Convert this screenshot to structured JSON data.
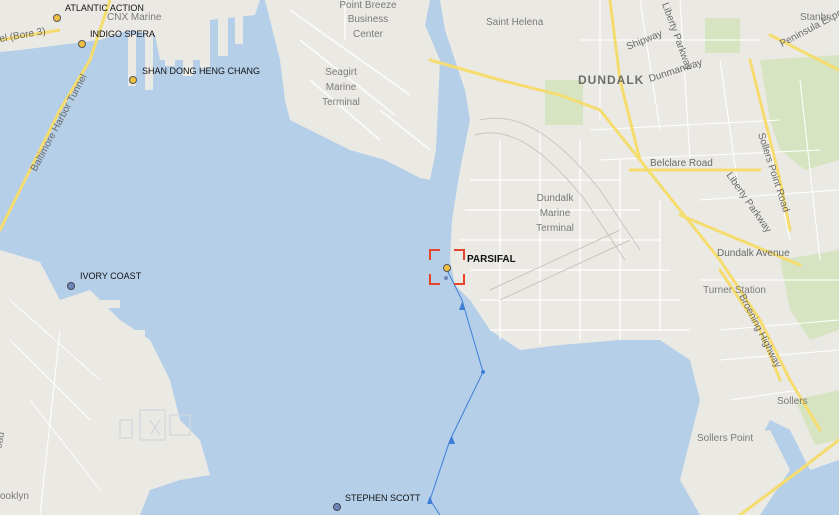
{
  "map": {
    "colors": {
      "water": "#b5cfe9",
      "land": "#ebe9e4",
      "park": "#d6e4c2",
      "major_road": "#f5dc6e",
      "track_line": "#3f7ed6",
      "selection": "#e2452b",
      "vessel_marker": "#6b86b8",
      "vessel_label_marker": "#f0c040"
    },
    "places": {
      "point_breeze": [
        "Point Breeze",
        "Business",
        "Center"
      ],
      "seagirt": [
        "Seagirt",
        "Marine",
        "Terminal"
      ],
      "saint_helena": "Saint Helena",
      "dundalk": "DUNDALK",
      "dundalk_marine": [
        "Dundalk",
        "Marine",
        "Terminal"
      ],
      "turner_station": "Turner Station",
      "sollers": "Sollers",
      "sollers_point": "Sollers Point",
      "stanbr": "Stanbr",
      "brooklyn": "ooklyn",
      "cnx_marine": "CNX Marine",
      "road_edge": "oad"
    },
    "roads": {
      "shipway": "Shipway",
      "dunmanway": "Dunmanway",
      "liberty_parkway_n": "Liberty Parkway",
      "liberty_parkway_s": "Liberty Parkway",
      "belclare_road": "Belclare Road",
      "sollers_point_road": "Sollers Point Road",
      "dundalk_avenue": "Dundalk Avenue",
      "broening_highway": "Broening Highway",
      "peninsula_expressway": "Peninsula Expr",
      "baltimore_harbor_tunnel": "Baltimore Harbor Tunnel",
      "bore_route": "el (Bore 3)"
    },
    "vessels": {
      "selected": "PARSIFAL",
      "atlantic_action": "ATLANTIC ACTION",
      "indigo_spera": "INDIGO SPERA",
      "shan_dong": "SHAN DONG HENG CHANG",
      "ivory_coast": "IVORY COAST",
      "stephen_scott": "STEPHEN SCOTT"
    }
  }
}
